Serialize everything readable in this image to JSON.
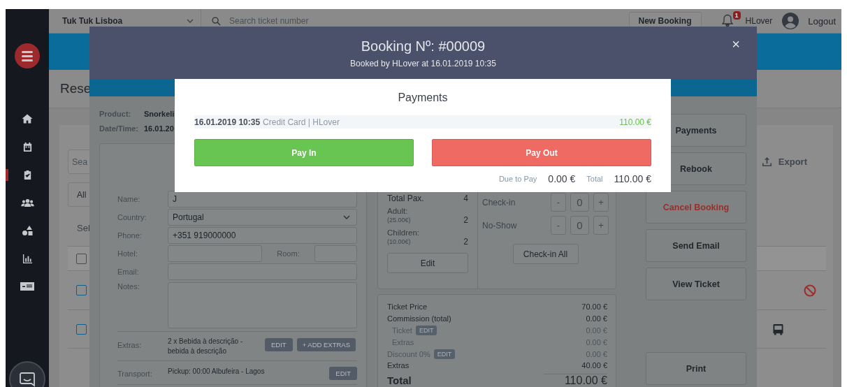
{
  "sidebar": {
    "items": [
      {
        "kind": "home",
        "selected": false
      },
      {
        "kind": "calendar",
        "selected": false
      },
      {
        "kind": "clipboard",
        "selected": true
      },
      {
        "kind": "users",
        "selected": false
      },
      {
        "kind": "shapes",
        "selected": false
      },
      {
        "kind": "chart",
        "selected": false
      },
      {
        "kind": "cash",
        "selected": false
      }
    ]
  },
  "topbar": {
    "company": "Tuk Tuk Lisboa",
    "search_placeholder": "Search ticket number",
    "new_booking": "New Booking",
    "notification_count": "1",
    "user": "HLover",
    "logout": "Logout"
  },
  "page": {
    "title": "Rese",
    "search_placeholder": "Sea",
    "filter": "All",
    "select_label": "Sel",
    "export": "Export",
    "rows": [
      {
        "kind": "header",
        "checked": false
      },
      {
        "kind": "cancelled",
        "checked": false
      },
      {
        "kind": "transport",
        "checked": false
      }
    ]
  },
  "booking": {
    "title": "Booking Nº: #00009",
    "subtitle": "Booked by HLover at 16.01.2019 10:35",
    "close": "×",
    "product_label": "Product:",
    "product": "Snorkeli",
    "datetime_label": "Date/Time:",
    "datetime": "16.01.20",
    "fields": [
      {
        "kind": "text",
        "label": "Name:",
        "value": "J"
      },
      {
        "kind": "select",
        "label": "Country:",
        "value": "Portugal"
      },
      {
        "kind": "text",
        "label": "Phone:",
        "value": "+351 919000000"
      },
      {
        "kind": "split",
        "label": "Hotel:",
        "second_label": "Room:"
      },
      {
        "kind": "text",
        "label": "Email:"
      },
      {
        "kind": "textarea",
        "label": "Notes:"
      }
    ],
    "extras": {
      "label": "Extras:",
      "text": "2 x Bebida à descrição - bebida à descrição",
      "edit": "EDIT",
      "add": "+ ADD EXTRAS"
    },
    "transport": {
      "label": "Transport:",
      "text": "Pickup: 00:00 Albufeira - Lagos",
      "edit": "EDIT"
    },
    "pax": {
      "total_label": "Total Pax.",
      "total": "4",
      "groups": [
        {
          "label": "Adult:",
          "price": "(25.00€)",
          "count": "2"
        },
        {
          "label": "Children:",
          "price": "(10.00€)",
          "count": "2"
        }
      ],
      "edit": "Edit",
      "counters": [
        {
          "label": "Check-in",
          "minus": "-",
          "value": "0",
          "plus": "+"
        },
        {
          "label": "No-Show",
          "minus": "-",
          "value": "0",
          "plus": "+"
        }
      ],
      "checkin_all": "Check-in All"
    },
    "prices": [
      {
        "kind": "main",
        "label": "Ticket Price",
        "value": "70.00 €"
      },
      {
        "kind": "main",
        "label": "Commission (total)",
        "value": "0.00 €"
      },
      {
        "kind": "sub",
        "label": "Ticket",
        "edit": "EDIT",
        "value": "0.00 €"
      },
      {
        "kind": "sub",
        "label": "Extras",
        "value": "0.00 €"
      },
      {
        "kind": "muted",
        "label": "Discount 0%",
        "edit": "EDIT",
        "value": "0.00 €"
      },
      {
        "kind": "main",
        "label": "Extras",
        "value": "40.00 €"
      },
      {
        "kind": "total",
        "label": "Total",
        "value": "110.00 €"
      }
    ],
    "actions": [
      {
        "kind": "default",
        "label": "Payments"
      },
      {
        "kind": "default",
        "label": "Rebook"
      },
      {
        "kind": "danger",
        "label": "Cancel Booking"
      },
      {
        "kind": "default",
        "label": "Send Email"
      },
      {
        "kind": "default",
        "label": "View Ticket"
      }
    ],
    "print": "Print"
  },
  "payments": {
    "title": "Payments",
    "entries": [
      {
        "datetime": "16.01.2019 10:35",
        "method": "Credit Card | HLover",
        "amount": "110.00 €"
      }
    ],
    "pay_in": "Pay In",
    "pay_out": "Pay Out",
    "due_label": "Due to Pay",
    "due": "0.00 €",
    "total_label": "Total",
    "total": "110.00 €"
  }
}
